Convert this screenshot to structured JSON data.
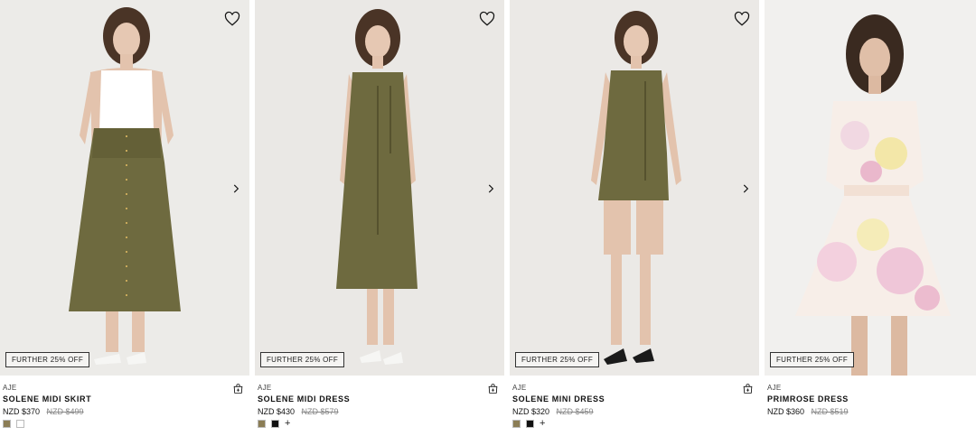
{
  "products": [
    {
      "brand": "AJE",
      "name": "SOLENE MIDI SKIRT",
      "price": "NZD $370",
      "was": "NZD $499",
      "promo": "FURTHER 25% OFF",
      "swatches": [
        "#8b7d55",
        "#ffffff"
      ],
      "more_colors": ""
    },
    {
      "brand": "AJE",
      "name": "SOLENE MIDI DRESS",
      "price": "NZD $430",
      "was": "NZD $579",
      "promo": "FURTHER 25% OFF",
      "swatches": [
        "#8b7d55",
        "#111111"
      ],
      "more_colors": "+"
    },
    {
      "brand": "AJE",
      "name": "SOLENE MINI DRESS",
      "price": "NZD $320",
      "was": "NZD $459",
      "promo": "FURTHER 25% OFF",
      "swatches": [
        "#8b7d55",
        "#111111"
      ],
      "more_colors": "+"
    },
    {
      "brand": "AJE",
      "name": "PRIMROSE DRESS",
      "price": "NZD $360",
      "was": "NZD $519",
      "promo": "FURTHER 25% OFF",
      "swatches": [],
      "more_colors": ""
    }
  ],
  "icons": {
    "wishlist": "heart-icon",
    "next_image": "chevron-right-icon",
    "quick_add": "bag-add-icon"
  },
  "colors": {
    "olive": "#6e6a3f",
    "backdrop": "#ebe9e6",
    "text": "#111111",
    "muted": "#888888"
  }
}
